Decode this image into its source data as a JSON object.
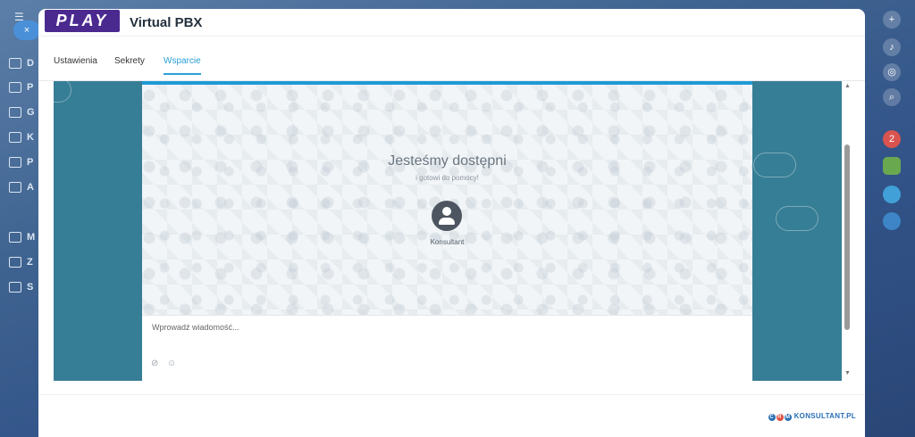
{
  "background": {
    "left_items": [
      "D",
      "P",
      "G",
      "K",
      "P",
      "A",
      "",
      "M",
      "Z",
      "S",
      "",
      ""
    ],
    "close_label": "×"
  },
  "header": {
    "logo_text": "PLAY",
    "title": "Virtual PBX"
  },
  "tabs": [
    {
      "label": "Ustawienia",
      "active": false
    },
    {
      "label": "Sekrety",
      "active": false
    },
    {
      "label": "Wsparcie",
      "active": true
    }
  ],
  "chat": {
    "title": "Jesteśmy dostępni",
    "subtitle": "i gotowi do pomocy!",
    "agent_name": "Konsultant",
    "input_placeholder": "Wprowadź wiadomość...",
    "accent_color": "#1e9ad6",
    "frame_color": "#367e95"
  },
  "footer": {
    "brand_text": "KONSULTANT.PL",
    "brand_marks": [
      "C",
      "R",
      "M"
    ]
  },
  "right_rail": {
    "badge_count": "2"
  }
}
